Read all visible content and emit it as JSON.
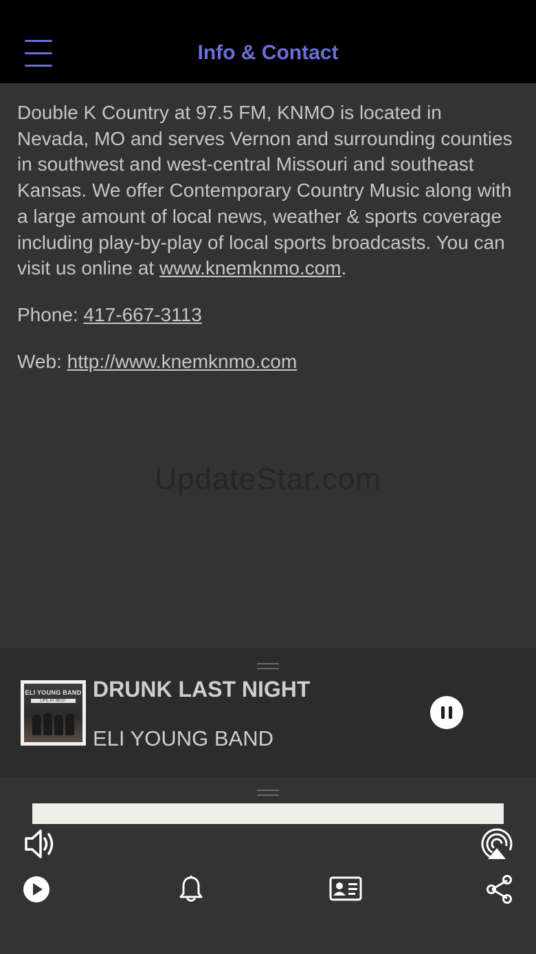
{
  "header": {
    "title": "Info & Contact"
  },
  "content": {
    "description": "Double K Country at 97.5 FM, KNMO is located in Nevada, MO and serves Vernon and surrounding counties in southwest and west-central Missouri and southeast Kansas. We offer Contemporary Country Music along with a large amount of local news, weather & sports coverage including play-by-play of local sports broadcasts. You can visit us online at ",
    "description_link": "www.knemknmo.com",
    "description_end": ".",
    "phone_label": "Phone: ",
    "phone_value": "417-667-3113",
    "web_label": "Web: ",
    "web_value": "http://www.knemknmo.com"
  },
  "watermark": "UpdateStar.com",
  "now_playing": {
    "title": "DRUNK LAST NIGHT",
    "artist": "ELI YOUNG BAND",
    "album_band_text": "ELI YOUNG BAND",
    "album_sub_text": "LIFE AT BEST"
  },
  "toolbar": {
    "icons": [
      "volume-icon",
      "airplay-icon",
      "play-icon",
      "bell-icon",
      "contact-card-icon",
      "share-icon"
    ]
  },
  "colors": {
    "accent": "#6a6fd8",
    "background": "#333333",
    "header_bg": "#000000",
    "player_bg": "#2c2c2c"
  }
}
